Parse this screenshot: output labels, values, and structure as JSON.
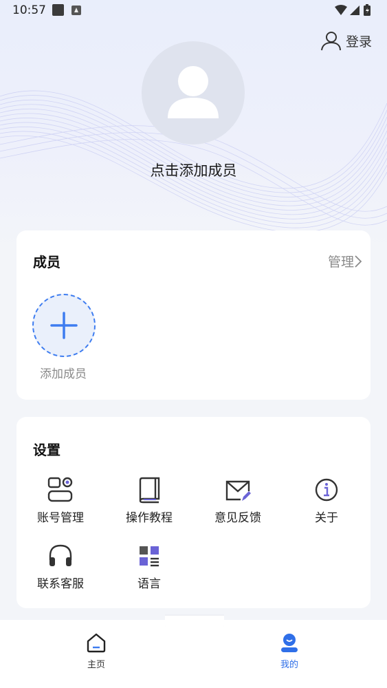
{
  "status_bar": {
    "time": "10:57"
  },
  "header": {
    "login_label": "登录"
  },
  "profile": {
    "add_member_prompt": "点击添加成员"
  },
  "members_card": {
    "title": "成员",
    "manage_label": "管理",
    "add_member_label": "添加成员"
  },
  "settings_card": {
    "title": "设置",
    "items": [
      {
        "label": "账号管理",
        "icon": "account-manage-icon"
      },
      {
        "label": "操作教程",
        "icon": "book-icon"
      },
      {
        "label": "意见反馈",
        "icon": "mail-edit-icon"
      },
      {
        "label": "关于",
        "icon": "info-icon"
      },
      {
        "label": "联系客服",
        "icon": "headset-icon"
      },
      {
        "label": "语言",
        "icon": "grid-list-icon"
      }
    ]
  },
  "bottom_nav": {
    "items": [
      {
        "label": "主页",
        "icon": "home-icon",
        "active": false
      },
      {
        "label": "我的",
        "icon": "profile-icon",
        "active": true
      }
    ]
  },
  "colors": {
    "accent": "#3d7cf0",
    "active_nav": "#2f6fe8",
    "muted_text": "#8a8a8a",
    "page_bg": "#f3f5f9"
  }
}
